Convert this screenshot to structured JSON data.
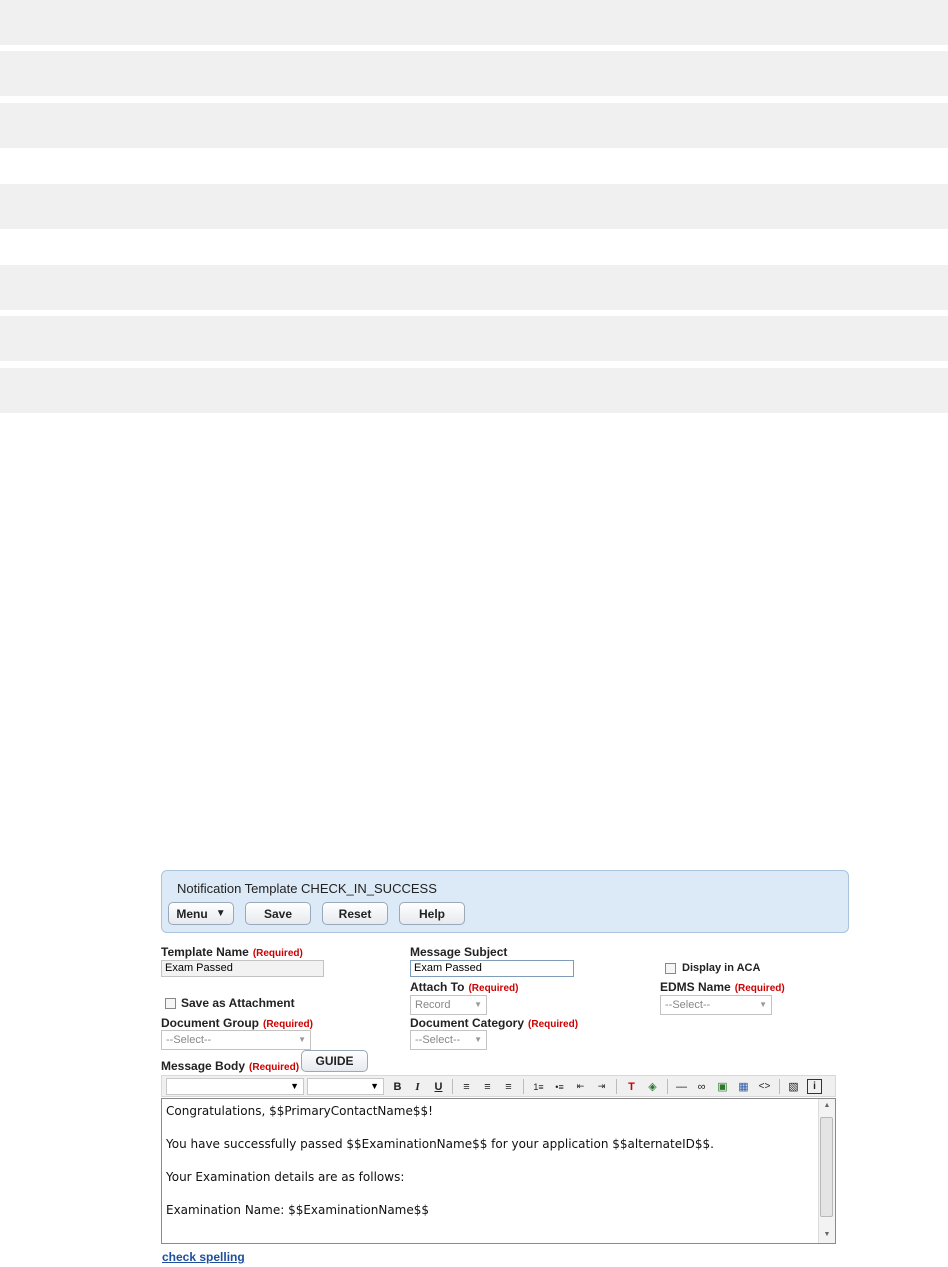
{
  "panel": {
    "title": "Notification Template CHECK_IN_SUCCESS",
    "buttons": {
      "menu": "Menu",
      "save": "Save",
      "reset": "Reset",
      "help": "Help"
    }
  },
  "form": {
    "required_text": "(Required)",
    "template_name": {
      "label": "Template Name",
      "value": "Exam Passed"
    },
    "message_subject": {
      "label": "Message Subject",
      "value": "Exam Passed"
    },
    "display_in_aca": {
      "label": "Display in ACA",
      "checked": false
    },
    "attach_to": {
      "label": "Attach To",
      "value": "Record"
    },
    "edms_name": {
      "label": "EDMS Name",
      "value": "--Select--"
    },
    "save_as_attachment": {
      "label": "Save as Attachment",
      "checked": false
    },
    "document_group": {
      "label": "Document Group",
      "value": "--Select--"
    },
    "document_category": {
      "label": "Document Category",
      "value": "--Select--"
    },
    "message_body": {
      "label": "Message Body"
    },
    "guide_button": "GUIDE"
  },
  "toolbar": {
    "icons": [
      "bold-icon",
      "italic-icon",
      "underline-icon",
      "align-left-icon",
      "align-center-icon",
      "align-right-icon",
      "ordered-list-icon",
      "unordered-list-icon",
      "outdent-icon",
      "indent-icon",
      "text-color-icon",
      "background-color-icon",
      "horizontal-rule-icon",
      "link-icon",
      "image-icon",
      "table-icon",
      "source-code-icon",
      "clean-format-icon",
      "info-icon"
    ]
  },
  "editor": {
    "lines": [
      "Congratulations, $$PrimaryContactName$$!",
      "You have successfully passed $$ExaminationName$$ for your application $$alternateID$$.",
      "Your Examination details are as follows:",
      "Examination Name: $$ExaminationName$$"
    ]
  },
  "footer": {
    "check_spelling": "check spelling"
  },
  "colors": {
    "panel_bg": "#dce9f6",
    "required": "#cc0000",
    "link": "#1f4e9c"
  }
}
